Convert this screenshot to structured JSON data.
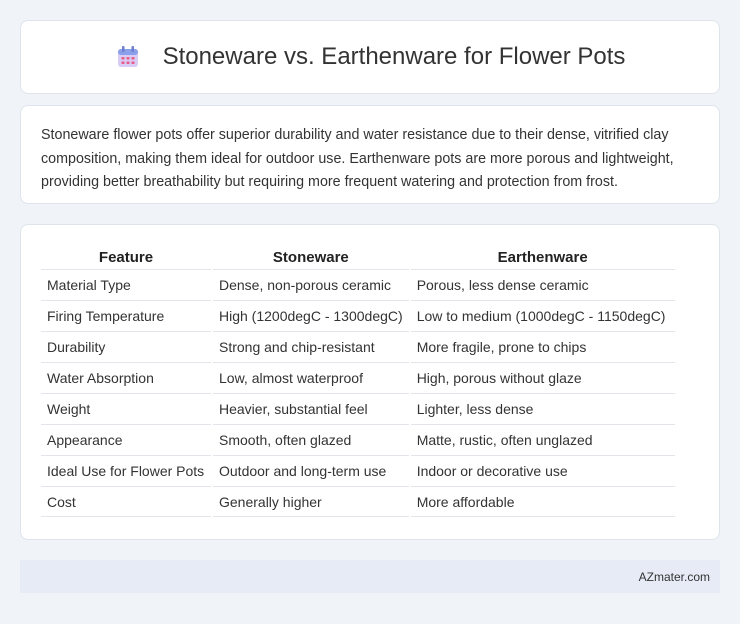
{
  "header": {
    "title": "Stoneware vs. Earthenware for Flower Pots",
    "icon": "calendar-icon"
  },
  "intro": {
    "text": "Stoneware flower pots offer superior durability and water resistance due to their dense, vitrified clay composition, making them ideal for outdoor use. Earthenware pots are more porous and lightweight, providing better breathability but requiring more frequent watering and protection from frost."
  },
  "table": {
    "headers": [
      "Feature",
      "Stoneware",
      "Earthenware"
    ],
    "rows": [
      [
        "Material Type",
        "Dense, non-porous ceramic",
        "Porous, less dense ceramic"
      ],
      [
        "Firing Temperature",
        "High (1200degC - 1300degC)",
        "Low to medium (1000degC - 1150degC)"
      ],
      [
        "Durability",
        "Strong and chip-resistant",
        "More fragile, prone to chips"
      ],
      [
        "Water Absorption",
        "Low, almost waterproof",
        "High, porous without glaze"
      ],
      [
        "Weight",
        "Heavier, substantial feel",
        "Lighter, less dense"
      ],
      [
        "Appearance",
        "Smooth, often glazed",
        "Matte, rustic, often unglazed"
      ],
      [
        "Ideal Use for Flower Pots",
        "Outdoor and long-term use",
        "Indoor or decorative use"
      ],
      [
        "Cost",
        "Generally higher",
        "More affordable"
      ]
    ]
  },
  "footer": {
    "brand": "AZmater.com"
  },
  "colors": {
    "background": "#f0f3f8",
    "icon_top": "#7b8fe0",
    "icon_body": "#c9b8f0",
    "footer_bg": "#e6ebf5"
  }
}
